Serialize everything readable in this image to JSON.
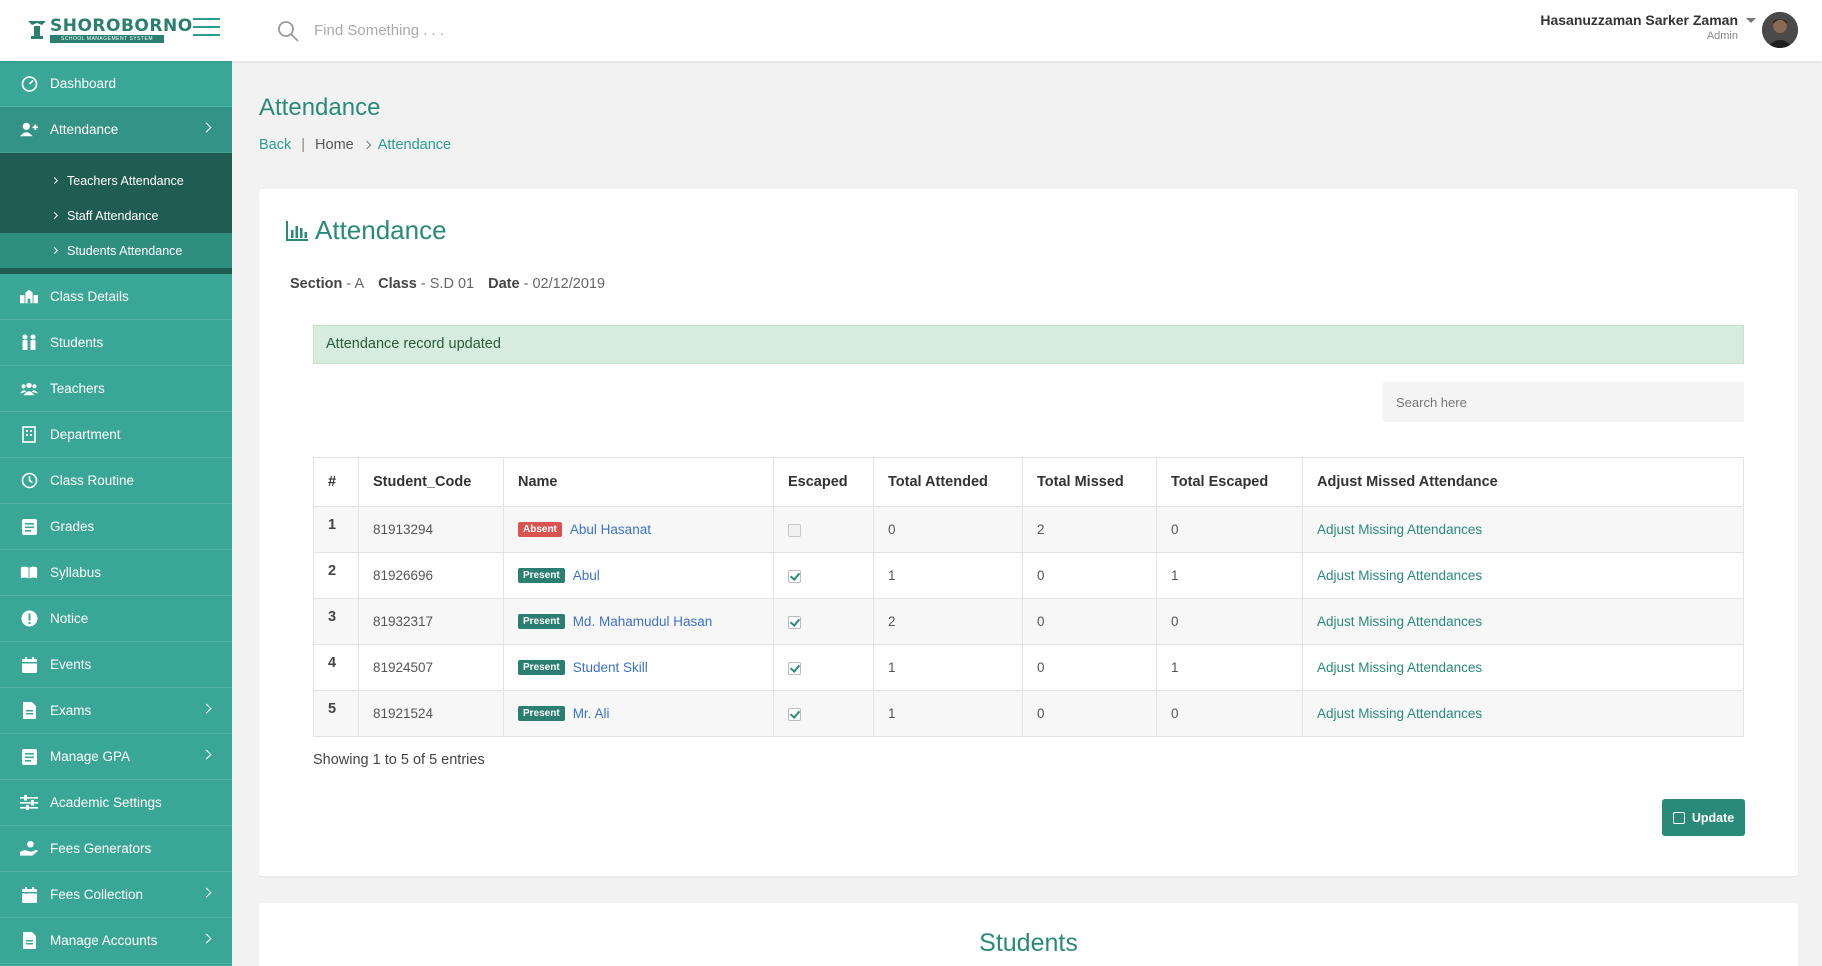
{
  "app": {
    "logo_text": "SHOROBORNO",
    "logo_subtext": "SCHOOL MANAGEMENT SYSTEM",
    "search_placeholder": "Find Something . . .",
    "user_name": "Hasanuzzaman Sarker Zaman",
    "user_role": "Admin"
  },
  "sidebar": {
    "items": [
      {
        "label": "Dashboard",
        "icon": "gauge-icon"
      },
      {
        "label": "Attendance",
        "icon": "user-plus-icon",
        "expanded": true
      },
      {
        "label": "Class Details",
        "icon": "school-icon"
      },
      {
        "label": "Students",
        "icon": "students-icon"
      },
      {
        "label": "Teachers",
        "icon": "users-icon"
      },
      {
        "label": "Department",
        "icon": "building-icon"
      },
      {
        "label": "Class Routine",
        "icon": "clock-icon"
      },
      {
        "label": "Grades",
        "icon": "list-icon"
      },
      {
        "label": "Syllabus",
        "icon": "book-icon"
      },
      {
        "label": "Notice",
        "icon": "exclamation-icon"
      },
      {
        "label": "Events",
        "icon": "calendar-icon"
      },
      {
        "label": "Exams",
        "icon": "file-icon"
      },
      {
        "label": "Manage GPA",
        "icon": "file-icon"
      },
      {
        "label": "Academic Settings",
        "icon": "sliders-icon"
      },
      {
        "label": "Fees Generators",
        "icon": "hand-coin-icon"
      },
      {
        "label": "Fees Collection",
        "icon": "calendar-icon"
      },
      {
        "label": "Manage Accounts",
        "icon": "file-icon"
      }
    ],
    "attendance_sub": [
      {
        "label": "Teachers Attendance"
      },
      {
        "label": "Staff Attendance"
      },
      {
        "label": "Students Attendance"
      }
    ]
  },
  "page": {
    "title": "Attendance",
    "breadcrumb": {
      "back": "Back",
      "sep": "|",
      "home": "Home",
      "current": "Attendance"
    }
  },
  "card": {
    "title": "Attendance",
    "meta": {
      "section_label": "Section",
      "section_value": "- A",
      "class_label": "Class",
      "class_value": "- S.D 01",
      "date_label": "Date",
      "date_value": "- 02/12/2019"
    },
    "alert": "Attendance record updated",
    "search_placeholder": "Search here",
    "columns": [
      "#",
      "Student_Code",
      "Name",
      "Escaped",
      "Total Attended",
      "Total Missed",
      "Total Escaped",
      "Adjust Missed Attendance"
    ],
    "rows": [
      {
        "idx": "1",
        "code": "81913294",
        "status": "Absent",
        "name": "Abul Hasanat",
        "escaped": false,
        "attended": "0",
        "missed": "2",
        "total_escaped": "0",
        "adjust": "Adjust Missing Attendances"
      },
      {
        "idx": "2",
        "code": "81926696",
        "status": "Present",
        "name": "Abul",
        "escaped": true,
        "attended": "1",
        "missed": "0",
        "total_escaped": "1",
        "adjust": "Adjust Missing Attendances"
      },
      {
        "idx": "3",
        "code": "81932317",
        "status": "Present",
        "name": "Md. Mahamudul Hasan",
        "escaped": true,
        "attended": "2",
        "missed": "0",
        "total_escaped": "0",
        "adjust": "Adjust Missing Attendances"
      },
      {
        "idx": "4",
        "code": "81924507",
        "status": "Present",
        "name": "Student Skill",
        "escaped": true,
        "attended": "1",
        "missed": "0",
        "total_escaped": "1",
        "adjust": "Adjust Missing Attendances"
      },
      {
        "idx": "5",
        "code": "81921524",
        "status": "Present",
        "name": "Mr. Ali",
        "escaped": true,
        "attended": "1",
        "missed": "0",
        "total_escaped": "0",
        "adjust": "Adjust Missing Attendances"
      }
    ],
    "entries_info": "Showing 1 to 5 of 5 entries",
    "update_label": "Update"
  },
  "card2": {
    "title": "Students"
  },
  "colors": {
    "accent": "#2a8a7a",
    "sidebar": "#3aa796",
    "submenu": "#1f5c52",
    "absent": "#d9534f",
    "alert_bg": "#d6ecdc"
  }
}
